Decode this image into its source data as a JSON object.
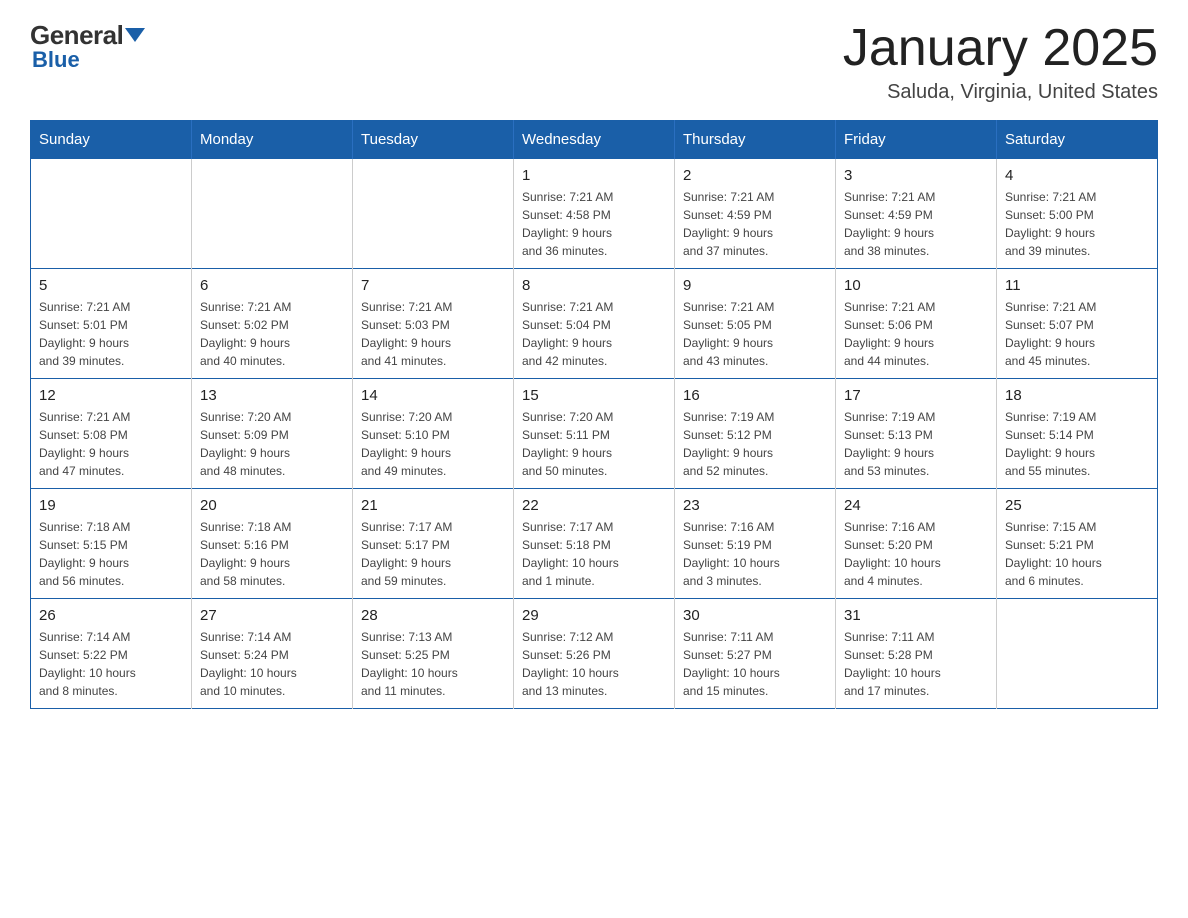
{
  "logo": {
    "general": "General",
    "blue": "Blue"
  },
  "title": "January 2025",
  "location": "Saluda, Virginia, United States",
  "days_header": [
    "Sunday",
    "Monday",
    "Tuesday",
    "Wednesday",
    "Thursday",
    "Friday",
    "Saturday"
  ],
  "weeks": [
    [
      {
        "day": "",
        "info": ""
      },
      {
        "day": "",
        "info": ""
      },
      {
        "day": "",
        "info": ""
      },
      {
        "day": "1",
        "info": "Sunrise: 7:21 AM\nSunset: 4:58 PM\nDaylight: 9 hours\nand 36 minutes."
      },
      {
        "day": "2",
        "info": "Sunrise: 7:21 AM\nSunset: 4:59 PM\nDaylight: 9 hours\nand 37 minutes."
      },
      {
        "day": "3",
        "info": "Sunrise: 7:21 AM\nSunset: 4:59 PM\nDaylight: 9 hours\nand 38 minutes."
      },
      {
        "day": "4",
        "info": "Sunrise: 7:21 AM\nSunset: 5:00 PM\nDaylight: 9 hours\nand 39 minutes."
      }
    ],
    [
      {
        "day": "5",
        "info": "Sunrise: 7:21 AM\nSunset: 5:01 PM\nDaylight: 9 hours\nand 39 minutes."
      },
      {
        "day": "6",
        "info": "Sunrise: 7:21 AM\nSunset: 5:02 PM\nDaylight: 9 hours\nand 40 minutes."
      },
      {
        "day": "7",
        "info": "Sunrise: 7:21 AM\nSunset: 5:03 PM\nDaylight: 9 hours\nand 41 minutes."
      },
      {
        "day": "8",
        "info": "Sunrise: 7:21 AM\nSunset: 5:04 PM\nDaylight: 9 hours\nand 42 minutes."
      },
      {
        "day": "9",
        "info": "Sunrise: 7:21 AM\nSunset: 5:05 PM\nDaylight: 9 hours\nand 43 minutes."
      },
      {
        "day": "10",
        "info": "Sunrise: 7:21 AM\nSunset: 5:06 PM\nDaylight: 9 hours\nand 44 minutes."
      },
      {
        "day": "11",
        "info": "Sunrise: 7:21 AM\nSunset: 5:07 PM\nDaylight: 9 hours\nand 45 minutes."
      }
    ],
    [
      {
        "day": "12",
        "info": "Sunrise: 7:21 AM\nSunset: 5:08 PM\nDaylight: 9 hours\nand 47 minutes."
      },
      {
        "day": "13",
        "info": "Sunrise: 7:20 AM\nSunset: 5:09 PM\nDaylight: 9 hours\nand 48 minutes."
      },
      {
        "day": "14",
        "info": "Sunrise: 7:20 AM\nSunset: 5:10 PM\nDaylight: 9 hours\nand 49 minutes."
      },
      {
        "day": "15",
        "info": "Sunrise: 7:20 AM\nSunset: 5:11 PM\nDaylight: 9 hours\nand 50 minutes."
      },
      {
        "day": "16",
        "info": "Sunrise: 7:19 AM\nSunset: 5:12 PM\nDaylight: 9 hours\nand 52 minutes."
      },
      {
        "day": "17",
        "info": "Sunrise: 7:19 AM\nSunset: 5:13 PM\nDaylight: 9 hours\nand 53 minutes."
      },
      {
        "day": "18",
        "info": "Sunrise: 7:19 AM\nSunset: 5:14 PM\nDaylight: 9 hours\nand 55 minutes."
      }
    ],
    [
      {
        "day": "19",
        "info": "Sunrise: 7:18 AM\nSunset: 5:15 PM\nDaylight: 9 hours\nand 56 minutes."
      },
      {
        "day": "20",
        "info": "Sunrise: 7:18 AM\nSunset: 5:16 PM\nDaylight: 9 hours\nand 58 minutes."
      },
      {
        "day": "21",
        "info": "Sunrise: 7:17 AM\nSunset: 5:17 PM\nDaylight: 9 hours\nand 59 minutes."
      },
      {
        "day": "22",
        "info": "Sunrise: 7:17 AM\nSunset: 5:18 PM\nDaylight: 10 hours\nand 1 minute."
      },
      {
        "day": "23",
        "info": "Sunrise: 7:16 AM\nSunset: 5:19 PM\nDaylight: 10 hours\nand 3 minutes."
      },
      {
        "day": "24",
        "info": "Sunrise: 7:16 AM\nSunset: 5:20 PM\nDaylight: 10 hours\nand 4 minutes."
      },
      {
        "day": "25",
        "info": "Sunrise: 7:15 AM\nSunset: 5:21 PM\nDaylight: 10 hours\nand 6 minutes."
      }
    ],
    [
      {
        "day": "26",
        "info": "Sunrise: 7:14 AM\nSunset: 5:22 PM\nDaylight: 10 hours\nand 8 minutes."
      },
      {
        "day": "27",
        "info": "Sunrise: 7:14 AM\nSunset: 5:24 PM\nDaylight: 10 hours\nand 10 minutes."
      },
      {
        "day": "28",
        "info": "Sunrise: 7:13 AM\nSunset: 5:25 PM\nDaylight: 10 hours\nand 11 minutes."
      },
      {
        "day": "29",
        "info": "Sunrise: 7:12 AM\nSunset: 5:26 PM\nDaylight: 10 hours\nand 13 minutes."
      },
      {
        "day": "30",
        "info": "Sunrise: 7:11 AM\nSunset: 5:27 PM\nDaylight: 10 hours\nand 15 minutes."
      },
      {
        "day": "31",
        "info": "Sunrise: 7:11 AM\nSunset: 5:28 PM\nDaylight: 10 hours\nand 17 minutes."
      },
      {
        "day": "",
        "info": ""
      }
    ]
  ]
}
